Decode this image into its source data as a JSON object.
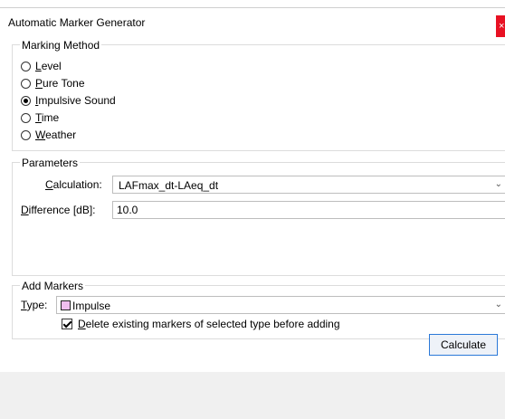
{
  "window": {
    "title": "Automatic Marker Generator",
    "close_glyph": "×"
  },
  "marking_method": {
    "caption": "Marking Method",
    "options": [
      {
        "pre": "",
        "ul": "L",
        "post": "evel",
        "checked": false
      },
      {
        "pre": "",
        "ul": "P",
        "post": "ure Tone",
        "checked": false
      },
      {
        "pre": "",
        "ul": "I",
        "post": "mpulsive Sound",
        "checked": true
      },
      {
        "pre": "",
        "ul": "T",
        "post": "ime",
        "checked": false
      },
      {
        "pre": "",
        "ul": "W",
        "post": "eather",
        "checked": false
      }
    ]
  },
  "parameters": {
    "caption": "Parameters",
    "calculation_ul": "C",
    "calculation_rest": "alculation:",
    "calculation_value": "LAFmax_dt-LAeq_dt",
    "difference_ul": "D",
    "difference_rest": "ifference [dB]:",
    "difference_value": "10.0"
  },
  "add_markers": {
    "caption": "Add Markers",
    "type_ul": "T",
    "type_rest": "ype:",
    "type_value": "Impulse",
    "type_color": "#f1bff0",
    "delete_ul": "D",
    "delete_rest": "elete existing markers of selected type before adding",
    "delete_checked": true
  },
  "actions": {
    "calculate_label": "Calculate"
  }
}
